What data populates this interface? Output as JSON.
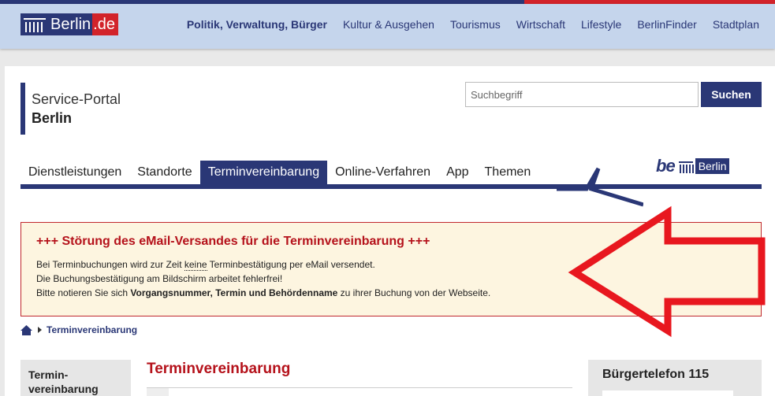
{
  "header": {
    "logo_text": "Berlin",
    "logo_suffix": ".de",
    "nav": [
      {
        "label": "Politik, Verwaltung, Bürger",
        "bold": true
      },
      {
        "label": "Kultur & Ausgehen"
      },
      {
        "label": "Tourismus"
      },
      {
        "label": "Wirtschaft"
      },
      {
        "label": "Lifestyle"
      },
      {
        "label": "BerlinFinder"
      },
      {
        "label": "Stadtplan"
      }
    ]
  },
  "portal": {
    "title_line1": "Service-Portal",
    "title_line2": "Berlin"
  },
  "search": {
    "placeholder": "Suchbegriff",
    "button_label": "Suchen"
  },
  "mainnav": {
    "tabs": [
      {
        "label": "Dienstleistungen"
      },
      {
        "label": "Standorte"
      },
      {
        "label": "Terminvereinbarung",
        "active": true
      },
      {
        "label": "Online-Verfahren"
      },
      {
        "label": "App"
      },
      {
        "label": "Themen"
      }
    ]
  },
  "be_logo": {
    "be": "be",
    "name": "Berlin"
  },
  "alert": {
    "title": "+++ Störung des eMail-Versandes für die Terminvereinbarung +++",
    "line1_pre": "Bei Terminbuchungen wird zur Zeit ",
    "line1_kw": "keine",
    "line1_post": " Terminbestätigung per eMail versendet.",
    "line2": "Die Buchungsbestätigung am Bildschirm arbeitet fehlerfrei!",
    "line3_pre": "Bitte notieren Sie sich ",
    "line3_bold": "Vorgangsnummer, Termin und Behördenname",
    "line3_post": " zu ihrer Buchung von der Webseite."
  },
  "breadcrumb": {
    "current": "Terminvereinbarung"
  },
  "sidebar": {
    "title_line1": "Termin-",
    "title_line2": "vereinbarung"
  },
  "content": {
    "title": "Terminvereinbarung"
  },
  "rightbox": {
    "title": "Bürgertelefon 115"
  },
  "colors": {
    "brand_blue": "#2a3776",
    "brand_red": "#d2232a",
    "alert_red": "#b5121b",
    "alert_bg": "#fdf5e0",
    "overlay_arrow": "#e8171f"
  },
  "icons": {
    "home": "home-icon",
    "breadcrumb_separator": "triangle-right-icon",
    "annotation": "red-arrow-annotation"
  }
}
